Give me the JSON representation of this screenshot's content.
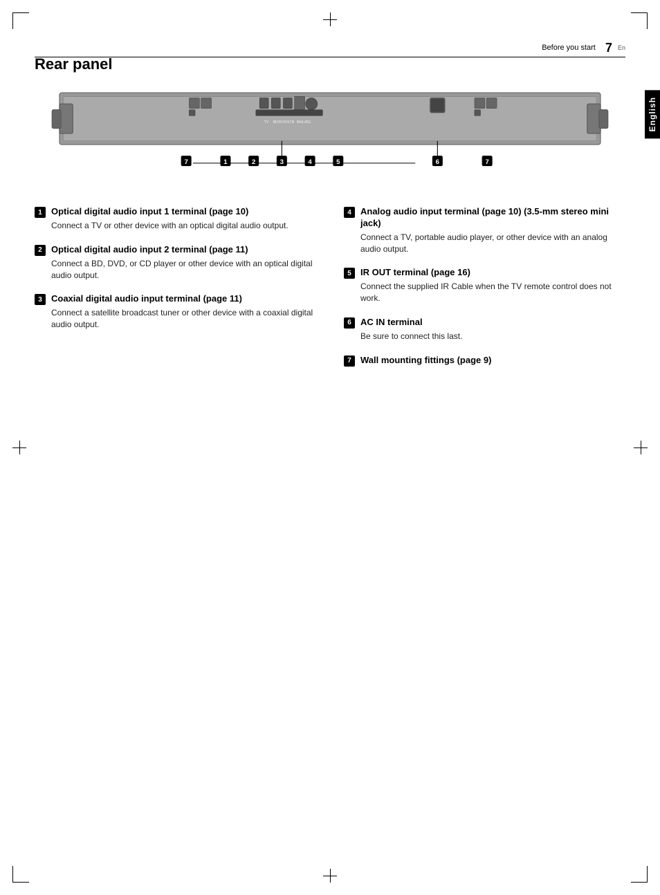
{
  "page": {
    "section": "Before you start",
    "page_number": "7",
    "lang_code": "En"
  },
  "side_tab": "English",
  "section_title": "Rear panel",
  "items": [
    {
      "id": "1",
      "title": "Optical digital audio input 1 terminal (page 10)",
      "body": "Connect a TV or other device with an optical digital audio output."
    },
    {
      "id": "2",
      "title": "Optical digital audio input 2 terminal (page 11)",
      "body": "Connect a BD, DVD, or CD player or other device with an optical digital audio output."
    },
    {
      "id": "3",
      "title": "Coaxial digital audio input terminal (page 11)",
      "body": "Connect a satellite broadcast tuner or other device with a coaxial digital audio output."
    },
    {
      "id": "4",
      "title": "Analog audio input terminal (page 10) (3.5-mm stereo mini jack)",
      "body": "Connect a TV, portable audio player, or other device with an analog audio output."
    },
    {
      "id": "5",
      "title": "IR OUT terminal (page 16)",
      "body": "Connect the supplied IR Cable when the TV remote control does not work."
    },
    {
      "id": "6",
      "title": "AC IN terminal",
      "body": "Be sure to connect this last."
    },
    {
      "id": "7",
      "title": "Wall mounting fittings (page 9)",
      "body": ""
    }
  ]
}
